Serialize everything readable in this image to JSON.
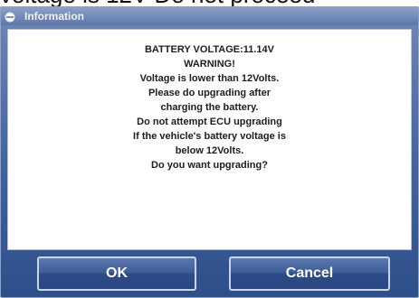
{
  "background_text": "voltage is 12V Do not proceed",
  "dialog": {
    "title": "Information",
    "title_icon": "circle-icon",
    "message_lines": [
      "BATTERY VOLTAGE:11.14V",
      "WARNING!",
      "Voltage is lower than 12Volts.",
      "Please do upgrading after",
      "charging the battery.",
      "Do not attempt ECU upgrading",
      "If the vehicle's battery voltage is",
      "below 12Volts.",
      "Do you want upgrading?"
    ],
    "ok_label": "OK",
    "cancel_label": "Cancel"
  },
  "colors": {
    "dialog_blue": "#44629b",
    "button_blue": "#3e5c97",
    "panel_white": "#ffffff",
    "text_dark": "#1d1d1d"
  }
}
